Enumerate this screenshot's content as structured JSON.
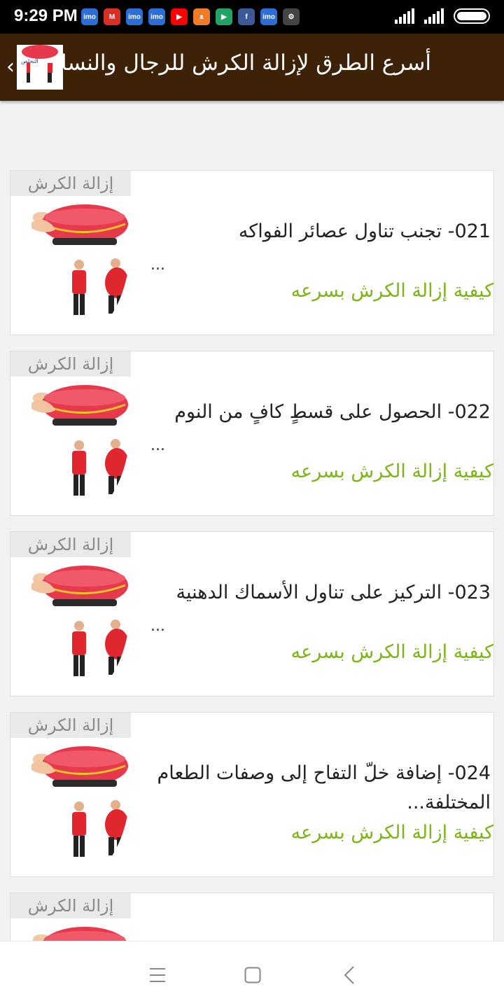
{
  "status_bar": {
    "time": "9:29 PM",
    "notification_icons": [
      {
        "name": "imo-icon",
        "label": "imo",
        "color": "#2b6fd6"
      },
      {
        "name": "gmail-icon",
        "label": "M",
        "color": "#d93025"
      },
      {
        "name": "imo-icon",
        "label": "imo",
        "color": "#2b6fd6"
      },
      {
        "name": "imo-icon",
        "label": "imo",
        "color": "#2b6fd6"
      },
      {
        "name": "youtube-icon",
        "label": "▶",
        "color": "#ff0000"
      },
      {
        "name": "cat-app-icon",
        "label": "ᴥ",
        "color": "#f07c2a"
      },
      {
        "name": "play-store-icon",
        "label": "▶",
        "color": "#21a366"
      },
      {
        "name": "facebook-icon",
        "label": "f",
        "color": "#3b5998"
      },
      {
        "name": "imo-icon",
        "label": "imo",
        "color": "#2b6fd6"
      },
      {
        "name": "gear-app-icon",
        "label": "⚙",
        "color": "#444444"
      }
    ]
  },
  "app_bar": {
    "title": "أسرع الطرق لإزالة الكرش للرجال والنساء"
  },
  "cards": [
    {
      "tag": "إزالة الكرش",
      "title": "021- تجنب تناول عصائر الفواكه",
      "ellipsis": "...",
      "category": "كيفية إزالة الكرش بسرعه"
    },
    {
      "tag": "إزالة الكرش",
      "title": "022- الحصول على قسطٍ كافٍ من النوم",
      "ellipsis": "...",
      "category": "كيفية إزالة الكرش بسرعه"
    },
    {
      "tag": "إزالة الكرش",
      "title": "023- التركيز على تناول الأسماك الدهنية",
      "ellipsis": "...",
      "category": "كيفية إزالة الكرش بسرعه"
    },
    {
      "tag": "إزالة الكرش",
      "title": "024- إضافة خلّ التفاح إلى وصفات الطعام المختلفة...",
      "ellipsis": "",
      "category": "كيفية إزالة الكرش بسرعه"
    },
    {
      "tag": "إزالة الكرش"
    }
  ],
  "colors": {
    "app_bar": "#3d2208",
    "category_text": "#7cb518",
    "tag_background": "#e9e9e9"
  }
}
